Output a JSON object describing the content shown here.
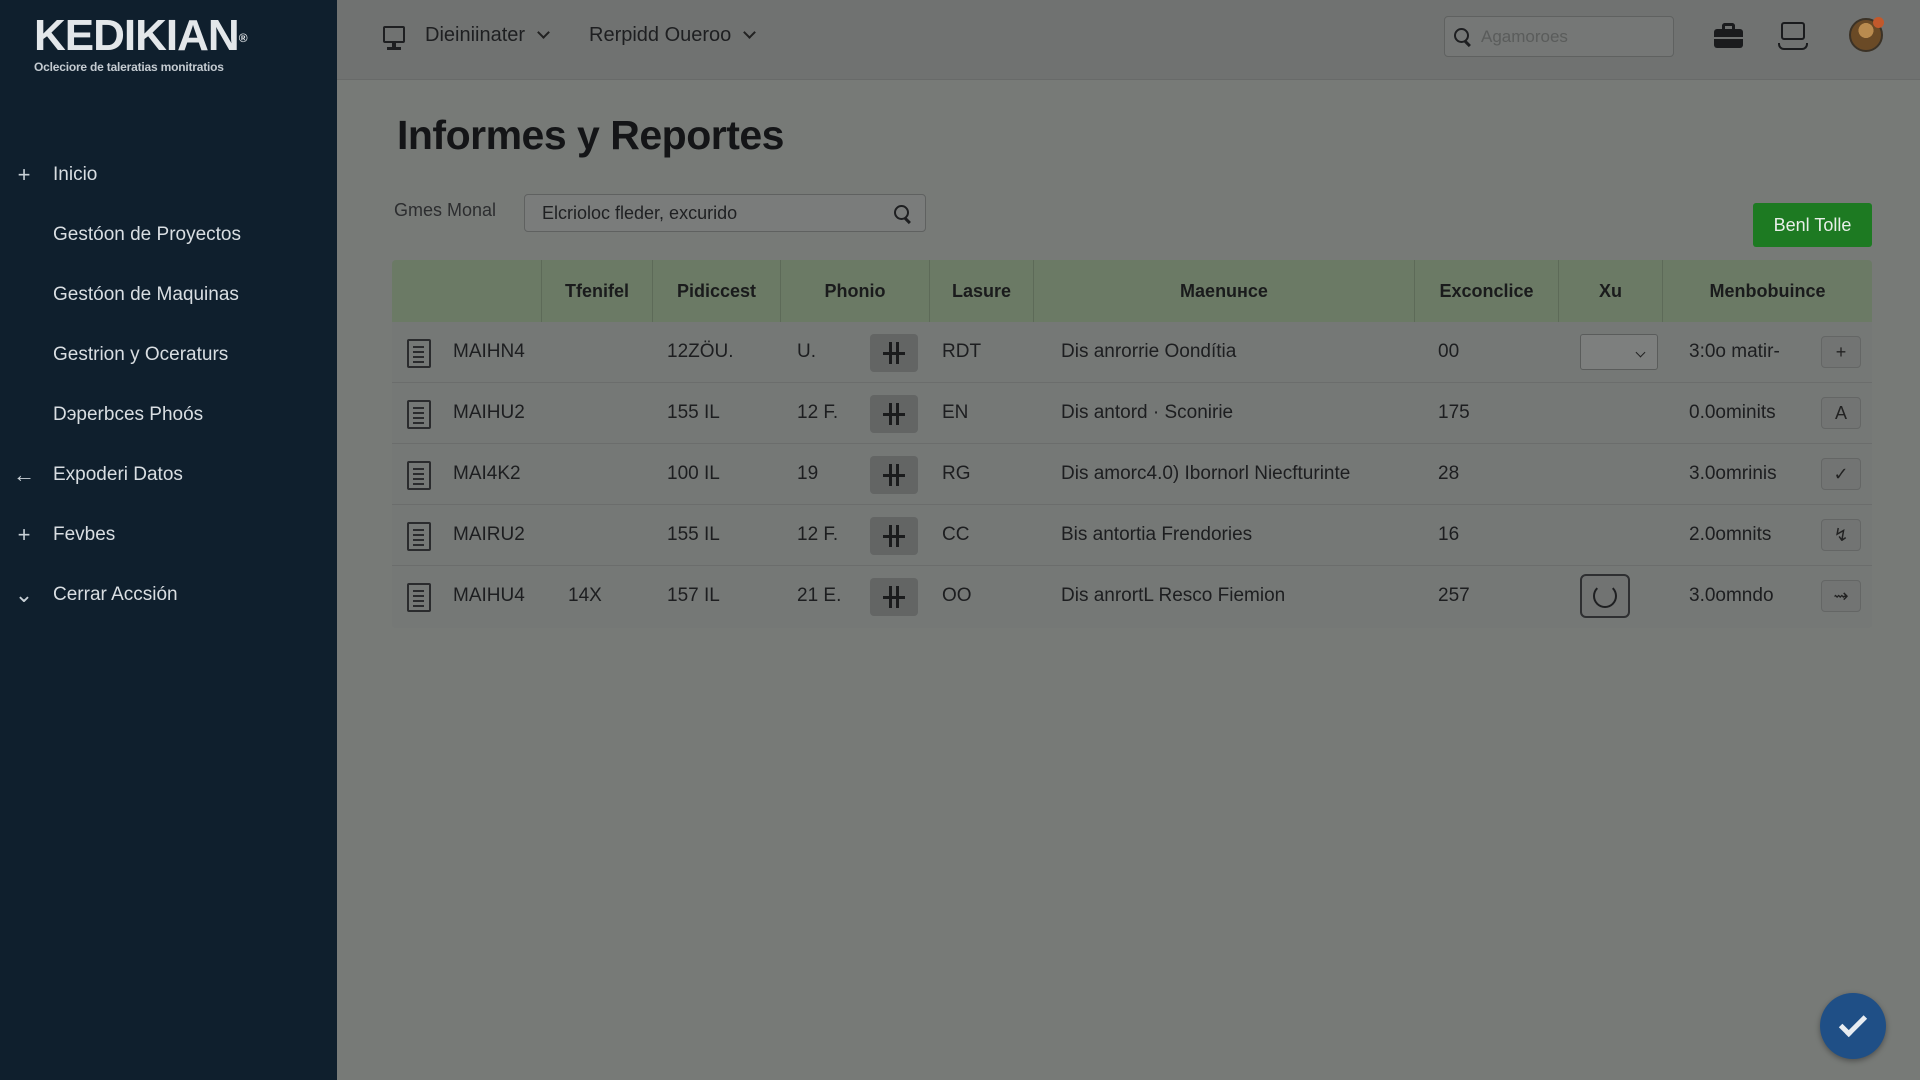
{
  "app": {
    "logo_title": "KEDIKIAN",
    "logo_mark": "®",
    "logo_subtitle": "Ocleciore de taleratias monitratios"
  },
  "sidebar": {
    "items": [
      {
        "label": "Inicio",
        "glyph": "+",
        "icon": "plus-icon"
      },
      {
        "label": "Gestóon de Proyectos",
        "glyph": "",
        "icon": ""
      },
      {
        "label": "Gestóon de Maquinas",
        "glyph": "",
        "icon": ""
      },
      {
        "label": "Gestrion y Oceraturs",
        "glyph": "",
        "icon": ""
      },
      {
        "label": "Dэperbces Phoós",
        "glyph": "",
        "icon": ""
      },
      {
        "label": "Expoderi Datos",
        "glyph": "←",
        "icon": "arrow-left-icon"
      },
      {
        "label": "Fevbes",
        "glyph": "+",
        "icon": "plus-icon"
      },
      {
        "label": "Cerrar Accsión",
        "glyph": "⌄",
        "icon": "chevron-down-icon"
      }
    ]
  },
  "topbar": {
    "menu1": "Dieiniinater",
    "menu2": "Rerpidd Oueroo",
    "search_placeholder": "Agamoroes"
  },
  "main": {
    "title": "Informes y Reportes",
    "filter_label": "Gmes Monal",
    "filter_value": "Elcrioloc fleder, excurido",
    "primary_button": "Benl Tolle"
  },
  "table": {
    "headers": [
      "",
      "Tfenifel",
      "Pidiccest",
      "Phonio",
      "Lasure",
      "Maenuнce",
      "Exconclice",
      "Xu",
      "Menbobuince"
    ],
    "rows": [
      {
        "code": "MAIHN4",
        "tfenifel": "",
        "pidiccest": "12ZÖU.",
        "phonio": "U.",
        "lasure": "RDT",
        "maenunce": "Dis anrorrie Oondítia",
        "exconclice": "00",
        "xu": "select",
        "menbobuince": "3:0o matir-",
        "action": "+"
      },
      {
        "code": "MAIHU2",
        "tfenifel": "",
        "pidiccest": "155 IL",
        "phonio": "12 F.",
        "lasure": "EN",
        "maenunce": "Dis antord · Sconirie",
        "exconclice": "175",
        "xu": "",
        "menbobuince": "0.0ominits",
        "action": "A"
      },
      {
        "code": "MAI4K2",
        "tfenifel": "",
        "pidiccest": "100 IL",
        "phonio": "19",
        "lasure": "RG",
        "maenunce": "Dis amorc4.0) Ibornorl Niecfturinte",
        "exconclice": "28",
        "xu": "",
        "menbobuince": "3.0omrinis",
        "action": "✓"
      },
      {
        "code": "MAIRU2",
        "tfenifel": "",
        "pidiccest": "155 IL",
        "phonio": "12 F.",
        "lasure": "CC",
        "maenunce": "Bis antortia Frendories",
        "exconclice": "16",
        "xu": "",
        "menbobuince": "2.0omnits",
        "action": "↯"
      },
      {
        "code": "MAIHU4",
        "tfenifel": "14X",
        "pidiccest": "157 IL",
        "phonio": "21 E.",
        "lasure": "OO",
        "maenunce": "Dis anrortL Resco Fiemion",
        "exconclice": "257",
        "xu": "spinner",
        "menbobuince": "3.0omndo",
        "action": "⇝"
      }
    ]
  },
  "colors": {
    "sidebar_bg": "#0f1f2d",
    "accent_green": "#1d7a22",
    "fab_blue": "#1f4f86"
  }
}
